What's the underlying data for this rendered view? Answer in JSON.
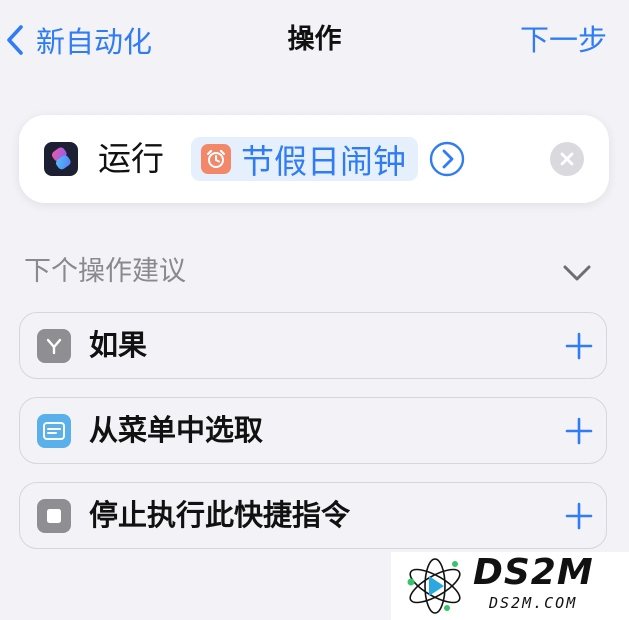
{
  "nav": {
    "back_label": "新自动化",
    "title": "操作",
    "next_label": "下一步"
  },
  "action": {
    "run_label": "运行",
    "shortcut_name": "节假日闹钟"
  },
  "suggestions": {
    "header": "下个操作建议",
    "items": [
      {
        "label": "如果",
        "icon": "branch-icon",
        "icon_color": "#8e8e93"
      },
      {
        "label": "从菜单中选取",
        "icon": "menu-icon",
        "icon_color": "#5ab0ea"
      },
      {
        "label": "停止执行此快捷指令",
        "icon": "stop-icon",
        "icon_color": "#8e8e93"
      }
    ]
  },
  "watermark": {
    "title": "DS2M",
    "subtitle": "DS2M.COM"
  },
  "colors": {
    "accent": "#2f7cf6",
    "background": "#f2f2f7",
    "alarm_icon": "#f3876a"
  }
}
